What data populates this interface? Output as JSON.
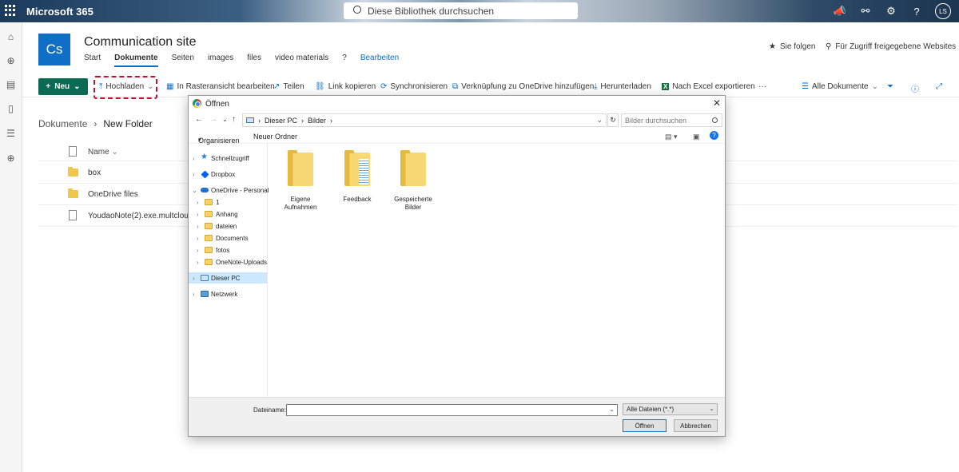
{
  "suite": {
    "brand": "Microsoft 365",
    "search_placeholder": "Diese Bibliothek durchsuchen",
    "avatar": "LS"
  },
  "site": {
    "logo": "Cs",
    "title": "Communication site",
    "nav": [
      "Start",
      "Dokumente",
      "Seiten",
      "images",
      "files",
      "video materials",
      "?"
    ],
    "edit": "Bearbeiten",
    "follow": "Sie folgen",
    "shared": "Für Zugriff freigegebene Websites"
  },
  "commands": {
    "new": "Neu",
    "upload": "Hochladen",
    "grid": "In Rasteransicht bearbeiten",
    "share": "Teilen",
    "copy_link": "Link kopieren",
    "sync": "Synchronisieren",
    "shortcut": "Verknüpfung zu OneDrive hinzufügen",
    "download": "Herunterladen",
    "excel": "Nach Excel exportieren",
    "more": "···",
    "view": "Alle Dokumente"
  },
  "library": {
    "breadcrumb_root": "Dokumente",
    "breadcrumb_current": "New Folder",
    "column_name": "Name",
    "rows": [
      {
        "name": "box",
        "type": "folder"
      },
      {
        "name": "OneDrive files",
        "type": "folder"
      },
      {
        "name": "YoudaoNote(2).exe.multcloud",
        "type": "file"
      }
    ]
  },
  "dialog": {
    "title": "Öffnen",
    "path": [
      "Dieser PC",
      "Bilder"
    ],
    "search_placeholder": "Bilder durchsuchen",
    "organize": "Organisieren",
    "new_folder": "Neuer Ordner",
    "tree": [
      {
        "label": "Schnellzugriff",
        "icon": "star-icon"
      },
      {
        "label": "Dropbox",
        "icon": "dropbox-icon"
      },
      {
        "label": "OneDrive - Personal",
        "icon": "cloud-icon"
      },
      {
        "label": "1",
        "icon": "folder-icon"
      },
      {
        "label": "Anhang",
        "icon": "folder-icon"
      },
      {
        "label": "dateien",
        "icon": "folder-icon"
      },
      {
        "label": "Documents",
        "icon": "folder-icon"
      },
      {
        "label": "fotos",
        "icon": "folder-icon"
      },
      {
        "label": "OneNote-Uploads",
        "icon": "folder-icon"
      },
      {
        "label": "Dieser PC",
        "icon": "pc-icon",
        "selected": true
      },
      {
        "label": "Netzwerk",
        "icon": "network-icon"
      }
    ],
    "folders": [
      {
        "line1": "Eigene",
        "line2": "Aufnahmen"
      },
      {
        "line1": "Feedback",
        "line2": ""
      },
      {
        "line1": "Gespeicherte",
        "line2": "Bilder"
      }
    ],
    "filename_label": "Dateiname:",
    "filetype": "Alle Dateien (*.*)",
    "open": "Öffnen",
    "cancel": "Abbrechen"
  },
  "colors": {
    "accent": "#106ebe",
    "new_button": "#0b6a53",
    "highlight": "#c8102e"
  }
}
